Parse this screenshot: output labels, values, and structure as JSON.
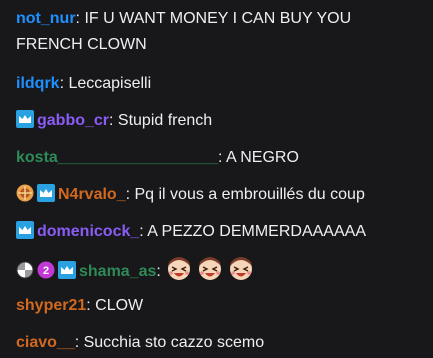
{
  "colors": {
    "background": "#18181b",
    "text": "#efeff1",
    "subscriber_badge": "#2aa1e0",
    "user_blue": "#1e90ff",
    "user_purple": "#8a5cf6",
    "user_green": "#2e8b57",
    "user_orange": "#d2691e"
  },
  "messages": [
    {
      "user": "not_nur",
      "sep": ": ",
      "text": "IF U WANT MONEY I CAN BUY YOU FRENCH CLOWN",
      "color": "#1e90ff",
      "badges": []
    },
    {
      "user": "ildqrk",
      "sep": ": ",
      "text": "Leccapiselli",
      "color": "#1e90ff",
      "badges": []
    },
    {
      "user": "gabbo_cr",
      "sep": ": ",
      "text": "Stupid french",
      "color": "#8a5cf6",
      "badges": [
        "subscriber-crown-icon"
      ]
    },
    {
      "user": "kosta__________________",
      "sep": ": ",
      "text": "A NEGRO",
      "color": "#2e8b57",
      "badges": []
    },
    {
      "user": "N4rvalo_",
      "sep": ": ",
      "text": "Pq il vous a embrouillés du coup",
      "color": "#d2691e",
      "badges": [
        "event-badge-icon",
        "subscriber-crown-icon"
      ]
    },
    {
      "user": "domenicock_",
      "sep": ": ",
      "text": "A PEZZO DEMMERDAAAAAA",
      "color": "#8a5cf6",
      "badges": [
        "subscriber-crown-icon"
      ]
    },
    {
      "user": "shama_as",
      "sep": ": ",
      "text": "",
      "color": "#2e8b57",
      "badges": [
        "pinwheel-badge-icon",
        "sub-gifter-2-badge-icon",
        "subscriber-crown-icon"
      ],
      "emotes": [
        "laughing-emote",
        "laughing-emote",
        "laughing-emote"
      ]
    },
    {
      "user": "shyper21",
      "sep": ": ",
      "text": "CLOW",
      "color": "#d2691e",
      "badges": []
    },
    {
      "user": "ciavo__",
      "sep": ": ",
      "text": "Succhia sto cazzo scemo",
      "color": "#d2691e",
      "badges": []
    }
  ]
}
